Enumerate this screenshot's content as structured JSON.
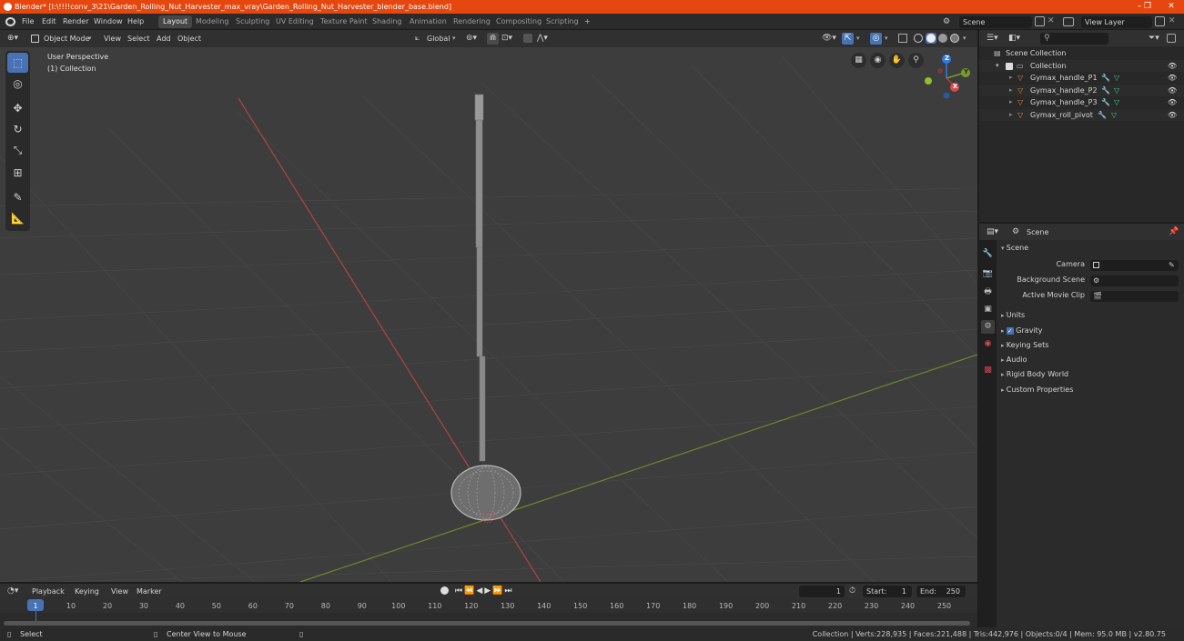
{
  "titlebar": {
    "title": "Blender* [I:\\!!!!conv_3\\21\\Garden_Rolling_Nut_Harvester_max_vray\\Garden_Rolling_Nut_Harvester_blender_base.blend]",
    "minimize": "–",
    "maximize": "❐",
    "close": "✕"
  },
  "menu": [
    "File",
    "Edit",
    "Render",
    "Window",
    "Help"
  ],
  "workspaces": [
    "Layout",
    "Modeling",
    "Sculpting",
    "UV Editing",
    "Texture Paint",
    "Shading",
    "Animation",
    "Rendering",
    "Compositing",
    "Scripting"
  ],
  "workspace_add": "+",
  "scene_field": "Scene",
  "view_layer_field": "View Layer",
  "viewport_header": {
    "mode": "Object Mode",
    "menus": [
      "View",
      "Select",
      "Add",
      "Object"
    ],
    "transform_orientation": "Global"
  },
  "viewport": {
    "perspective_label": "User Perspective",
    "collection_label": "(1) Collection",
    "gizmo": {
      "x": "X",
      "y": "Y",
      "z": "Z"
    }
  },
  "outliner": {
    "search_placeholder": "",
    "root": "Scene Collection",
    "collection": "Collection",
    "objects": [
      "Gymax_handle_P1",
      "Gymax_handle_P2",
      "Gymax_handle_P3",
      "Gymax_roll_pivot"
    ]
  },
  "properties": {
    "context": "Scene",
    "panel_title": "Scene",
    "fields": [
      {
        "label": "Camera",
        "value": ""
      },
      {
        "label": "Background Scene",
        "value": ""
      },
      {
        "label": "Active Movie Clip",
        "value": ""
      }
    ],
    "sections": [
      {
        "label": "Units",
        "checkbox": false
      },
      {
        "label": "Gravity",
        "checkbox": true
      },
      {
        "label": "Keying Sets",
        "checkbox": false
      },
      {
        "label": "Audio",
        "checkbox": false
      },
      {
        "label": "Rigid Body World",
        "checkbox": false
      },
      {
        "label": "Custom Properties",
        "checkbox": false
      }
    ]
  },
  "timeline": {
    "menus": [
      "Playback",
      "Keying",
      "View",
      "Marker"
    ],
    "current_frame": "1",
    "start_label": "Start:",
    "start": "1",
    "end_label": "End:",
    "end": "250",
    "ticks": [
      "1",
      "10",
      "20",
      "30",
      "40",
      "50",
      "60",
      "70",
      "80",
      "90",
      "100",
      "110",
      "120",
      "130",
      "140",
      "150",
      "160",
      "170",
      "180",
      "190",
      "200",
      "210",
      "220",
      "230",
      "240",
      "250"
    ]
  },
  "statusbar": {
    "select": "Select",
    "center_view": "Center View to Mouse",
    "stats": "Collection | Verts:228,935 | Faces:221,488 | Tris:442,976 | Objects:0/4 | Mem: 95.0 MB | v2.80.75"
  },
  "colors": {
    "titlebar": "#e5470f",
    "active_tool": "#4772b3",
    "x_axis": "#c0392b",
    "y_axis": "#7a9a2a",
    "z_axis": "#2f7be0",
    "mesh_icon": "#e2892f",
    "modifier_icon": "#5aa0e0"
  }
}
